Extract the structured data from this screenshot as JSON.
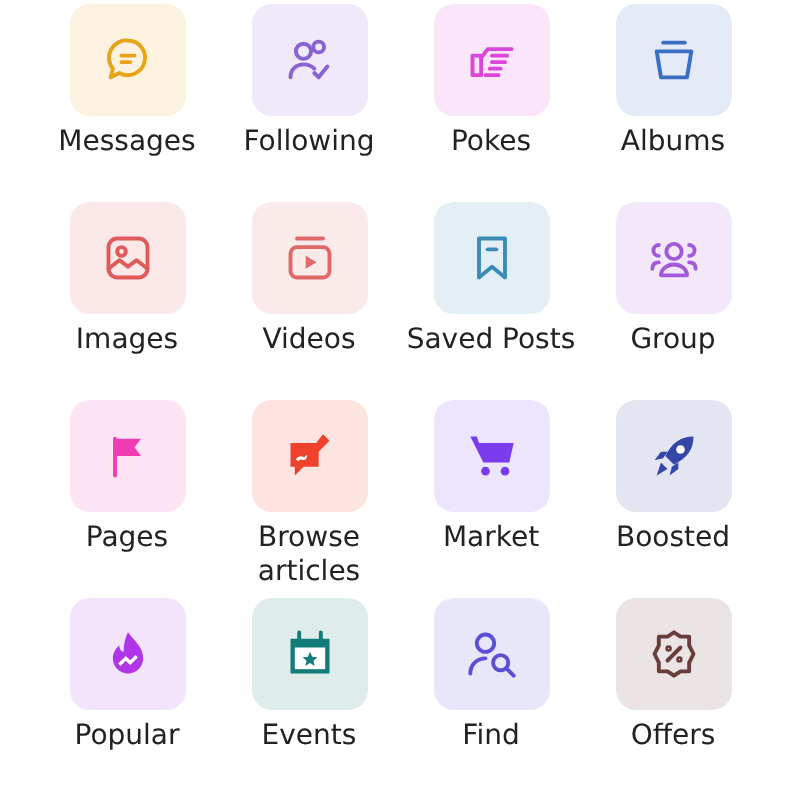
{
  "items": [
    {
      "label": "Messages",
      "color": "#e8a317"
    },
    {
      "label": "Following",
      "color": "#8a63d2"
    },
    {
      "label": "Pokes",
      "color": "#d946d9"
    },
    {
      "label": "Albums",
      "color": "#3b6fc4"
    },
    {
      "label": "Images",
      "color": "#e05a5a"
    },
    {
      "label": "Videos",
      "color": "#e06868"
    },
    {
      "label": "Saved Posts",
      "color": "#3a8cb5"
    },
    {
      "label": "Group",
      "color": "#a25ad9"
    },
    {
      "label": "Pages",
      "color": "#f03cb4"
    },
    {
      "label": "Browse articles",
      "color": "#f0412c"
    },
    {
      "label": "Market",
      "color": "#7b3cf0"
    },
    {
      "label": "Boosted",
      "color": "#3446a8"
    },
    {
      "label": "Popular",
      "color": "#b034e8"
    },
    {
      "label": "Events",
      "color": "#127d78"
    },
    {
      "label": "Find",
      "color": "#5b4fd6"
    },
    {
      "label": "Offers",
      "color": "#6b3c3c"
    }
  ]
}
